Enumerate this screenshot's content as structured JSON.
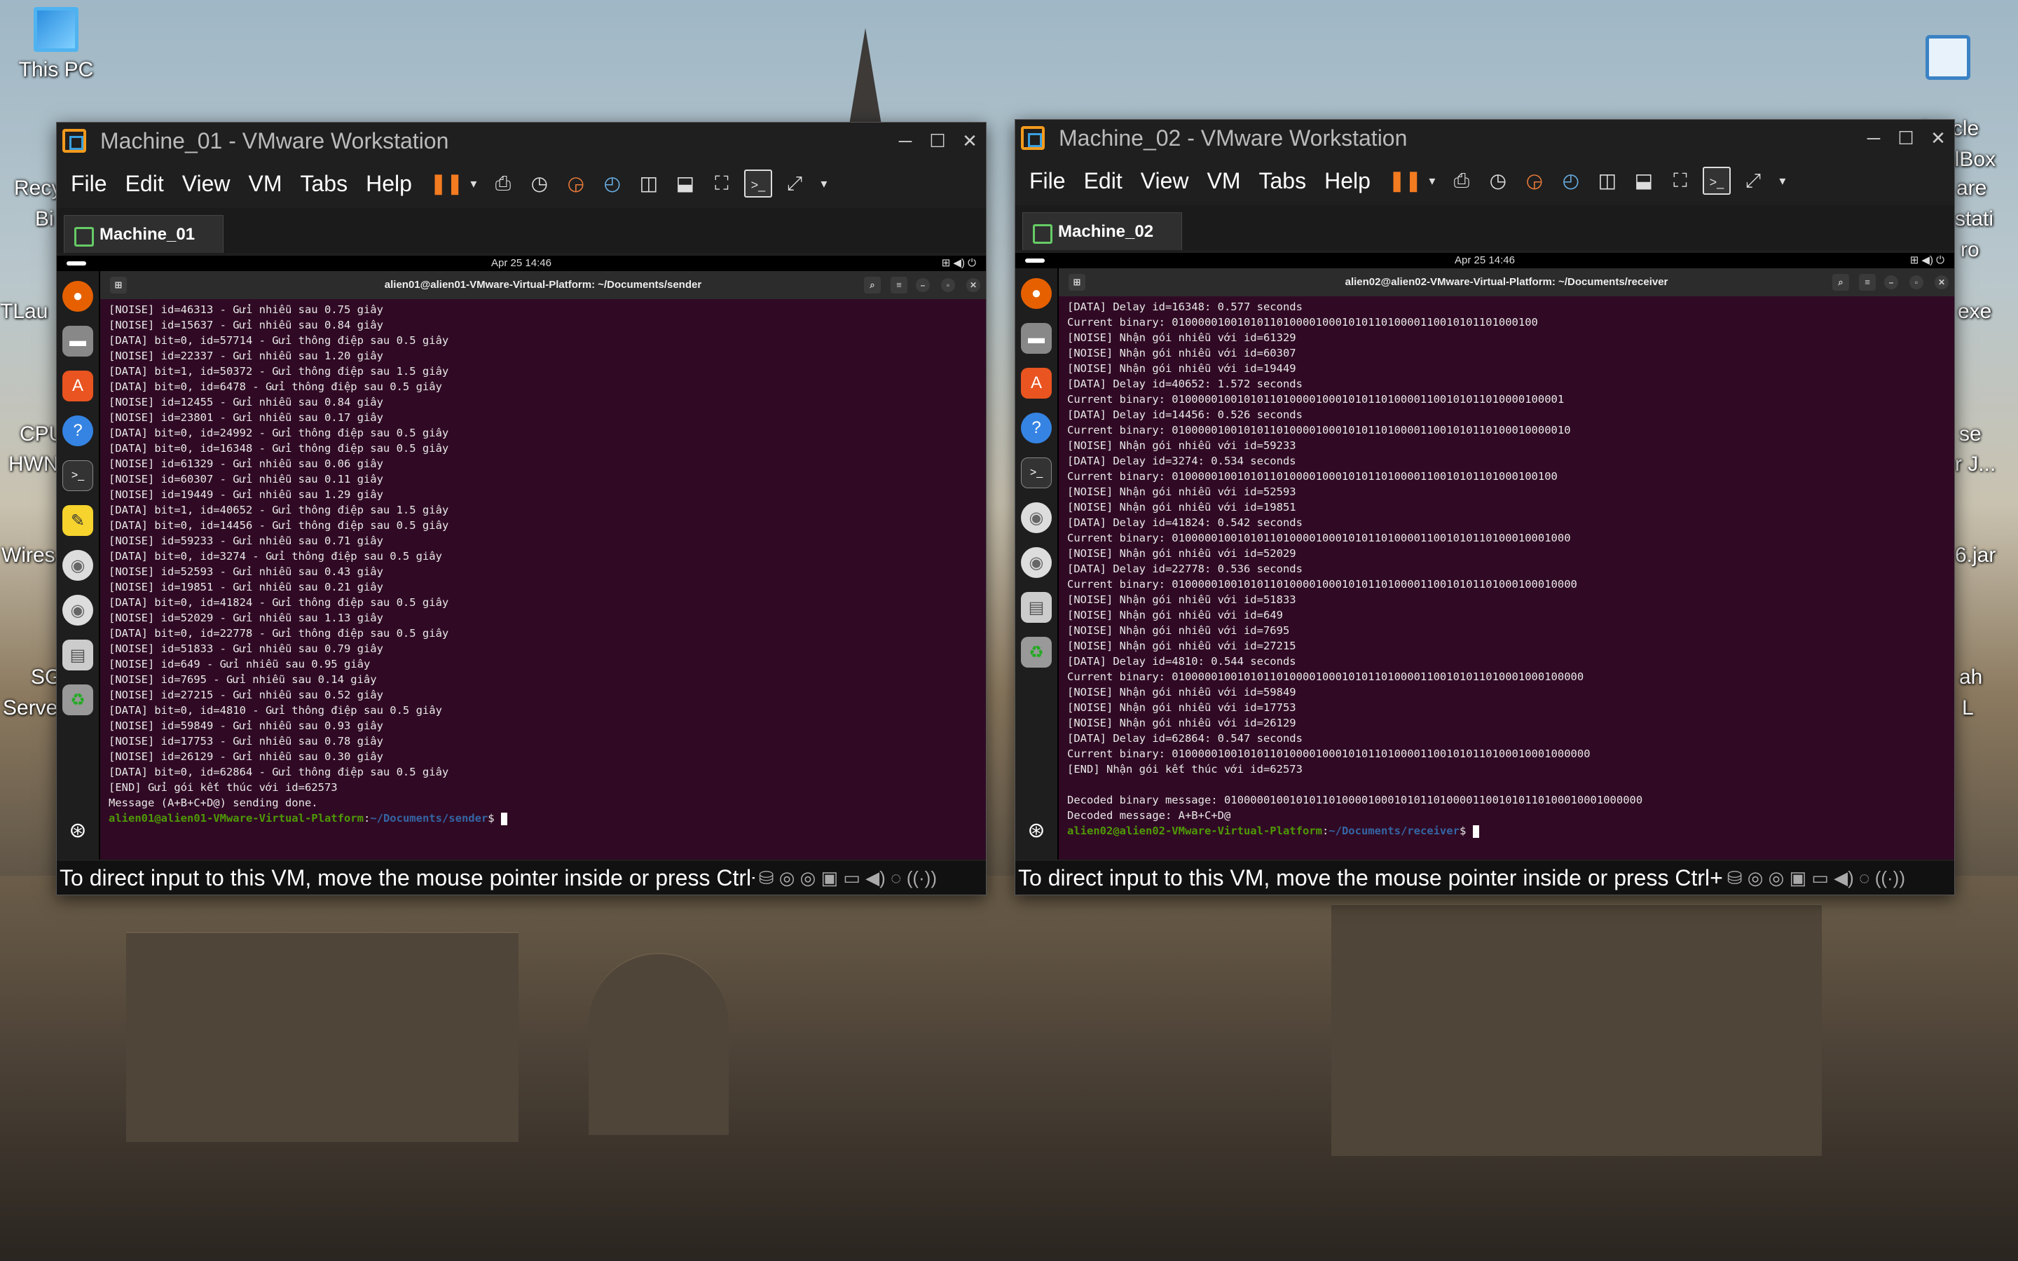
{
  "desktop": {
    "icons": [
      {
        "label": "This PC",
        "icon": "monitor-icon"
      },
      {
        "label": "Oracle\nVirtualBox",
        "icon": "virtualbox-icon"
      }
    ],
    "partial_labels": [
      "Recy",
      "Bi",
      "TLau",
      "CPU",
      "HWN",
      "Wires",
      "SG",
      "Serve",
      "are",
      "stati",
      "ro",
      "exe",
      "se",
      "r J...",
      "6.jar",
      "ah",
      "L"
    ]
  },
  "windows": [
    {
      "title": "Machine_01 - VMware Workstation",
      "menu": [
        "File",
        "Edit",
        "View",
        "VM",
        "Tabs",
        "Help"
      ],
      "tab": "Machine_01",
      "guest_clock": "Apr 25  14:46",
      "terminal_title": "alien01@alien01-VMware-Virtual-Platform: ~/Documents/sender",
      "lines": [
        "[NOISE] id=46313 - Gửi nhiễu sau 0.75 giây",
        "[NOISE] id=15637 - Gửi nhiễu sau 0.84 giây",
        "[DATA] bit=0, id=57714 - Gửi thông điệp sau 0.5 giây",
        "[NOISE] id=22337 - Gửi nhiễu sau 1.20 giây",
        "[DATA] bit=1, id=50372 - Gửi thông điệp sau 1.5 giây",
        "[DATA] bit=0, id=6478 - Gửi thông điệp sau 0.5 giây",
        "[NOISE] id=12455 - Gửi nhiễu sau 0.84 giây",
        "[NOISE] id=23801 - Gửi nhiễu sau 0.17 giây",
        "[DATA] bit=0, id=24992 - Gửi thông điệp sau 0.5 giây",
        "[DATA] bit=0, id=16348 - Gửi thông điệp sau 0.5 giây",
        "[NOISE] id=61329 - Gửi nhiễu sau 0.06 giây",
        "[NOISE] id=60307 - Gửi nhiễu sau 0.11 giây",
        "[NOISE] id=19449 - Gửi nhiễu sau 1.29 giây",
        "[DATA] bit=1, id=40652 - Gửi thông điệp sau 1.5 giây",
        "[DATA] bit=0, id=14456 - Gửi thông điệp sau 0.5 giây",
        "[NOISE] id=59233 - Gửi nhiễu sau 0.71 giây",
        "[DATA] bit=0, id=3274 - Gửi thông điệp sau 0.5 giây",
        "[NOISE] id=52593 - Gửi nhiễu sau 0.43 giây",
        "[NOISE] id=19851 - Gửi nhiễu sau 0.21 giây",
        "[DATA] bit=0, id=41824 - Gửi thông điệp sau 0.5 giây",
        "[NOISE] id=52029 - Gửi nhiễu sau 1.13 giây",
        "[DATA] bit=0, id=22778 - Gửi thông điệp sau 0.5 giây",
        "[NOISE] id=51833 - Gửi nhiễu sau 0.79 giây",
        "[NOISE] id=649 - Gửi nhiễu sau 0.95 giây",
        "[NOISE] id=7695 - Gửi nhiễu sau 0.14 giây",
        "[NOISE] id=27215 - Gửi nhiễu sau 0.52 giây",
        "[DATA] bit=0, id=4810 - Gửi thông điệp sau 0.5 giây",
        "[NOISE] id=59849 - Gửi nhiễu sau 0.93 giây",
        "[NOISE] id=17753 - Gửi nhiễu sau 0.78 giây",
        "[NOISE] id=26129 - Gửi nhiễu sau 0.30 giây",
        "[DATA] bit=0, id=62864 - Gửi thông điệp sau 0.5 giây",
        "[END] Gửi gói kết thúc với id=62573",
        "Message (A+B+C+D@) sending done."
      ],
      "prompt_user": "alien01@alien01-VMware-Virtual-Platform",
      "prompt_path": "~/Documents/sender",
      "status": "To direct input to this VM, move the mouse pointer inside or press Ctrl+G."
    },
    {
      "title": "Machine_02 - VMware Workstation",
      "menu": [
        "File",
        "Edit",
        "View",
        "VM",
        "Tabs",
        "Help"
      ],
      "tab": "Machine_02",
      "guest_clock": "Apr 25  14:46",
      "terminal_title": "alien02@alien02-VMware-Virtual-Platform: ~/Documents/receiver",
      "lines": [
        "[DATA] Delay id=16348: 0.577 seconds",
        "Current binary: 01000001001010110100001000101011010000110010101101000100",
        "[NOISE] Nhận gói nhiễu với id=61329",
        "[NOISE] Nhận gói nhiễu với id=60307",
        "[NOISE] Nhận gói nhiễu với id=19449",
        "[DATA] Delay id=40652: 1.572 seconds",
        "Current binary: 010000010010101101000010001010110100001100101011010000100001",
        "[DATA] Delay id=14456: 0.526 seconds",
        "Current binary: 0100000100101011010000100010101101000011001010110100010000010",
        "[NOISE] Nhận gói nhiễu với id=59233",
        "[DATA] Delay id=3274: 0.534 seconds",
        "Current binary: 01000001001010110100001000101011010000110010101101000100100",
        "[NOISE] Nhận gói nhiễu với id=52593",
        "[NOISE] Nhận gói nhiễu với id=19851",
        "[DATA] Delay id=41824: 0.542 seconds",
        "Current binary: 0100000100101011010000100010101101000011001010110100010001000",
        "[NOISE] Nhận gói nhiễu với id=52029",
        "[DATA] Delay id=22778: 0.536 seconds",
        "Current binary: 01000001001010110100001000101011010000110010101101000100010000",
        "[NOISE] Nhận gói nhiễu với id=51833",
        "[NOISE] Nhận gói nhiễu với id=649",
        "[NOISE] Nhận gói nhiễu với id=7695",
        "[NOISE] Nhận gói nhiễu với id=27215",
        "[DATA] Delay id=4810: 0.544 seconds",
        "Current binary: 010000010010101101000010001010110100001100101011010001000100000",
        "[NOISE] Nhận gói nhiễu với id=59849",
        "[NOISE] Nhận gói nhiễu với id=17753",
        "[NOISE] Nhận gói nhiễu với id=26129",
        "[DATA] Delay id=62864: 0.547 seconds",
        "Current binary: 0100000100101011010000100010101101000011001010110100010001000000",
        "[END] Nhận gói kết thúc với id=62573",
        "",
        "Decoded binary message: 0100000100101011010000100010101101000011001010110100010001000000",
        "Decoded message: A+B+C+D@"
      ],
      "prompt_user": "alien02@alien02-VMware-Virtual-Platform",
      "prompt_path": "~/Documents/receiver",
      "status": "To direct input to this VM, move the mouse pointer inside or press Ctrl+G."
    }
  ]
}
